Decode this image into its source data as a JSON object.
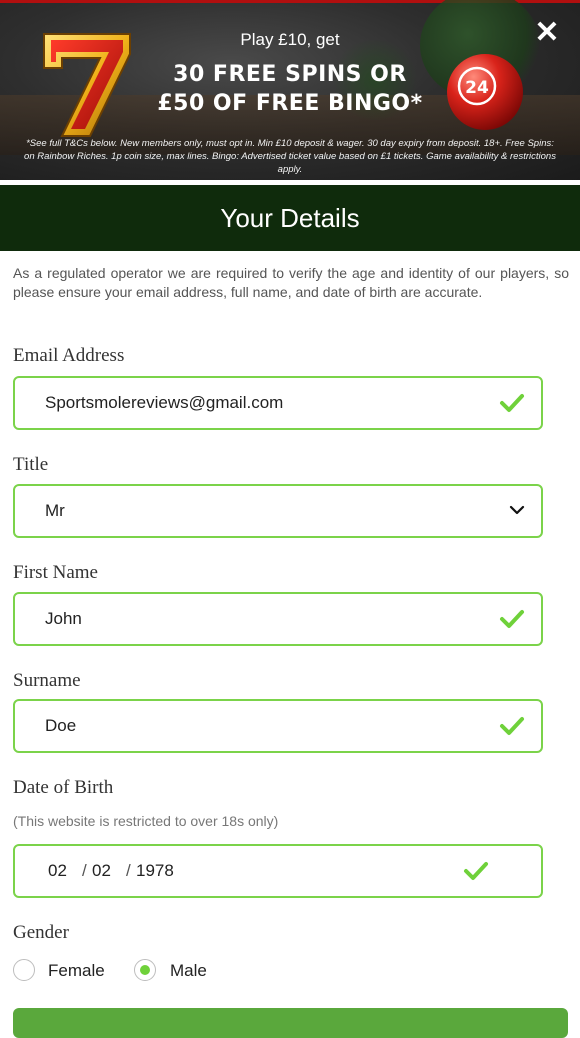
{
  "banner": {
    "lead": "Play £10, get",
    "headline_line1": "30 FREE SPINS OR",
    "headline_line2": "£50 OF FREE BINGO*",
    "terms": "*See full T&Cs below. New members only, must opt in. Min £10 deposit & wager. 30 day expiry from deposit. 18+. Free Spins: on Rainbow Riches. 1p coin size, max lines. Bingo: Advertised ticket value based on £1 tickets. Game availability & restrictions apply.",
    "ball_number": "24",
    "close_icon": "close-icon",
    "close_glyph": "✕"
  },
  "form": {
    "title": "Your Details",
    "intro": "As a regulated operator we are required to verify the age and identity of our players, so please ensure your email address, full name, and date of birth are accurate.",
    "email": {
      "label": "Email Address",
      "value": "Sportsmolereviews@gmail.com",
      "valid": true
    },
    "title_field": {
      "label": "Title",
      "selected": "Mr"
    },
    "first_name": {
      "label": "First Name",
      "value": "John",
      "valid": true
    },
    "surname": {
      "label": "Surname",
      "value": "Doe",
      "valid": true
    },
    "dob": {
      "label": "Date of Birth",
      "hint": "(This website is restricted to over 18s only)",
      "day": "02",
      "month": "02",
      "year": "1978",
      "separator": "/",
      "valid": true
    },
    "gender": {
      "label": "Gender",
      "options": [
        "Female",
        "Male"
      ],
      "selected": "Male"
    }
  },
  "colors": {
    "header_bg": "#0f2b0c",
    "valid_green": "#7bd34a",
    "banner_red": "#b10f0f",
    "submit_green": "#5aa83c"
  }
}
